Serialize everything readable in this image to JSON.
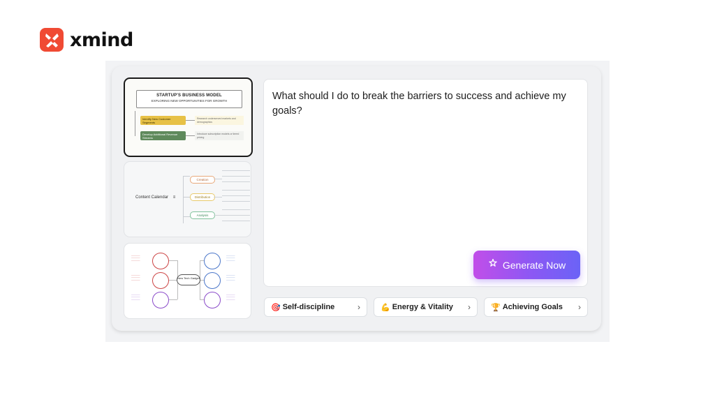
{
  "brand": {
    "name": "xmind",
    "accent": "#f04a33"
  },
  "templates": [
    {
      "title": "STARTUP'S BUSINESS MODEL",
      "subtitle": "EXPLORING NEW OPPORTUNITIES FOR GROWTH",
      "branch1": "Identify New Customer Segments",
      "branch1_note": "Research underserved markets and demographics",
      "branch2": "Develop Additional Revenue Streams",
      "branch2_note": "Introduce subscription models or tiered pricing"
    },
    {
      "center": "Content Calendar",
      "nodes": [
        "Creation",
        "Distribution",
        "Analysis"
      ]
    },
    {
      "center": "New Tech Gadget"
    }
  ],
  "prompt": {
    "text": "What should I do to break the barriers to success and achieve my goals?",
    "generate_label": "Generate Now",
    "generate_gradient_start": "#c14ee9",
    "generate_gradient_end": "#6b63f6"
  },
  "suggestions": [
    {
      "emoji": "🎯",
      "label": "Self-discipline"
    },
    {
      "emoji": "💪",
      "label": "Energy & Vitality"
    },
    {
      "emoji": "🏆",
      "label": "Achieving Goals"
    }
  ]
}
